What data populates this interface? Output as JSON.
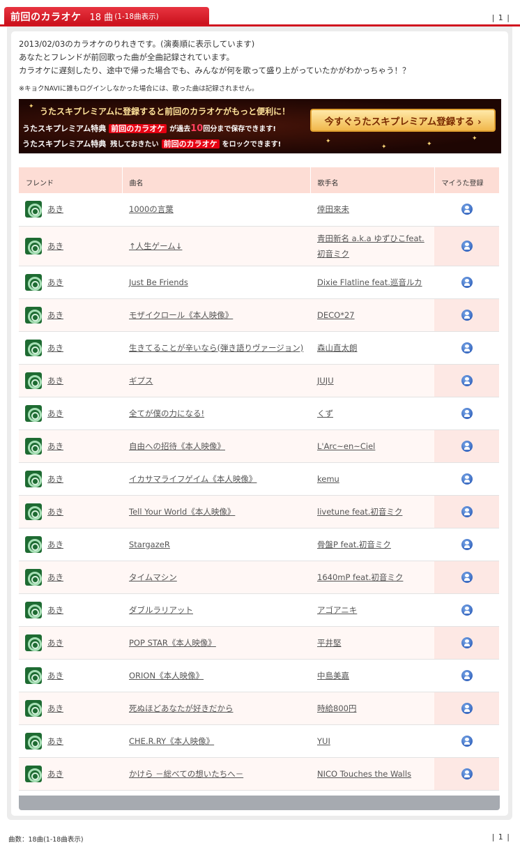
{
  "header": {
    "title": "前回のカラオケ",
    "count": "18 曲",
    "range": "(1-18曲表示)"
  },
  "pager": {
    "top": "| 1 |",
    "bottom": "| 1 |"
  },
  "intro": [
    "2013/02/03のカラオケのりれきです。(演奏順に表示しています)",
    "あなたとフレンドが前回歌った曲が全曲記録されています。",
    "カラオケに遅刻したり、途中で帰った場合でも、みんなが何を歌って盛り上がっていたかがわかっちゃう！？"
  ],
  "note": "※キョクNAVIに誰もログインしなかった場合には、歌った曲は記録されません。",
  "banner": {
    "line1": "うたスキプレミアムに登録すると前回のカラオケがもっと便利に！",
    "line2_a": "うたスキプレミアム特典",
    "line2_hl": "前回のカラオケ",
    "line2_b": "が過去",
    "line2_num": "10",
    "line2_c": "回分まで保存できます!",
    "line3_a": "うたスキプレミアム特典",
    "line3_b": "残しておきたい",
    "line3_hl": "前回のカラオケ",
    "line3_c": "をロックできます!",
    "cta": "今すぐうたスキプレミアム登録する ›"
  },
  "columns": [
    "フレンド",
    "曲名",
    "歌手名",
    "マイうた登録"
  ],
  "rows": [
    {
      "friend": "あき",
      "song": "1000の言葉",
      "artist": "倖田來未"
    },
    {
      "friend": "あき",
      "song": "↑人生ゲーム↓",
      "artist": "青田新名 a.k.a ゆずひこfeat.初音ミク"
    },
    {
      "friend": "あき",
      "song": "Just Be Friends",
      "artist": "Dixie Flatline feat.巡音ルカ"
    },
    {
      "friend": "あき",
      "song": "モザイクロール《本人映像》",
      "artist": "DECO*27"
    },
    {
      "friend": "あき",
      "song": "生きてることが辛いなら(弾き語りヴァージョン)",
      "artist": "森山直太朗"
    },
    {
      "friend": "あき",
      "song": "ギプス",
      "artist": "JUJU"
    },
    {
      "friend": "あき",
      "song": "全てが僕の力になる!",
      "artist": "くず"
    },
    {
      "friend": "あき",
      "song": "自由への招待《本人映像》",
      "artist": "L'Arc~en~Ciel"
    },
    {
      "friend": "あき",
      "song": "イカサマライフゲイム《本人映像》",
      "artist": "kemu"
    },
    {
      "friend": "あき",
      "song": "Tell Your World《本人映像》",
      "artist": "livetune feat.初音ミク"
    },
    {
      "friend": "あき",
      "song": "StargazeR",
      "artist": "骨盤P feat.初音ミク"
    },
    {
      "friend": "あき",
      "song": "タイムマシン",
      "artist": "1640mP feat.初音ミク"
    },
    {
      "friend": "あき",
      "song": "ダブルラリアット",
      "artist": "アゴアニキ"
    },
    {
      "friend": "あき",
      "song": "POP STAR《本人映像》",
      "artist": "平井堅"
    },
    {
      "friend": "あき",
      "song": "ORION《本人映像》",
      "artist": "中島美嘉"
    },
    {
      "friend": "あき",
      "song": "死ぬほどあなたが好きだから",
      "artist": "時給800円"
    },
    {
      "friend": "あき",
      "song": "CHE.R.RY《本人映像》",
      "artist": "YUI"
    },
    {
      "friend": "あき",
      "song": "かけら －総べての想いたちへ－",
      "artist": "NICO Touches the Walls"
    }
  ],
  "footer": {
    "count": "曲数：18曲(1-18曲表示)"
  },
  "colors": {
    "accent": "#d1131f",
    "header_row": "#fdddd5",
    "row_alt": "#fff7f5"
  },
  "icons": {
    "avatar": "friend-avatar-icon",
    "register": "my-song-register-icon"
  }
}
